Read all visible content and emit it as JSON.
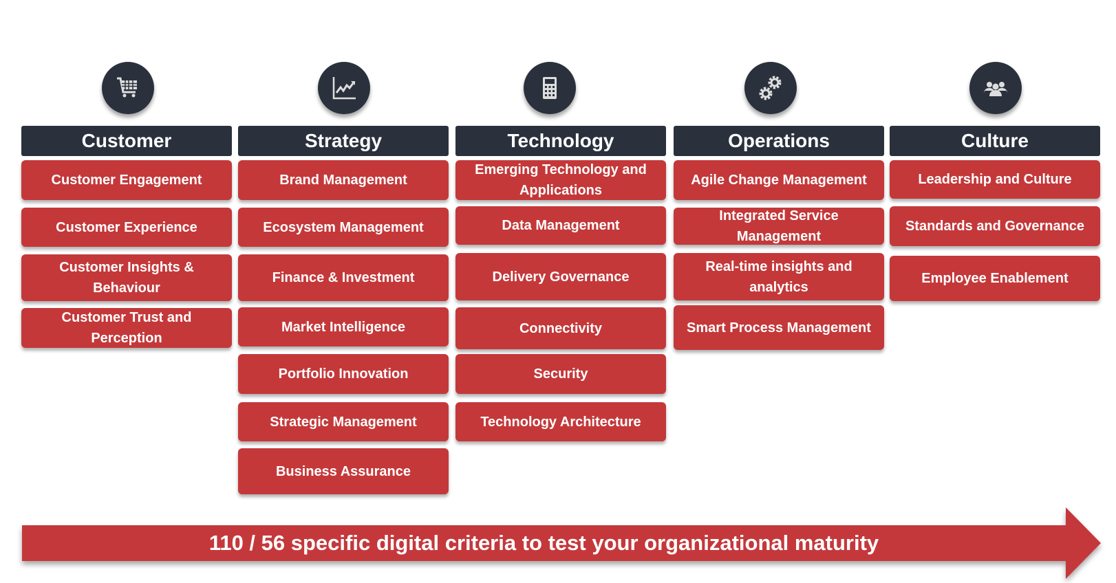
{
  "colors": {
    "accent": "#c4383a",
    "header": "#2a313c"
  },
  "columns": [
    {
      "title": "Customer",
      "icon": "shopping-cart-icon",
      "items": [
        "Customer Engagement",
        "Customer Experience",
        "Customer Insights & Behaviour",
        "Customer Trust and Perception"
      ]
    },
    {
      "title": "Strategy",
      "icon": "trend-chart-icon",
      "items": [
        "Brand Management",
        "Ecosystem Management",
        "Finance & Investment",
        "Market Intelligence",
        "Portfolio Innovation",
        "Strategic Management",
        "Business Assurance"
      ]
    },
    {
      "title": "Technology",
      "icon": "calculator-icon",
      "items": [
        "Emerging Technology and Applications",
        "Data Management",
        "Delivery Governance",
        "Connectivity",
        "Security",
        "Technology Architecture"
      ]
    },
    {
      "title": "Operations",
      "icon": "gears-icon",
      "items": [
        "Agile Change Management",
        "Integrated Service Management",
        "Real-time insights and analytics",
        "Smart Process Management"
      ]
    },
    {
      "title": "Culture",
      "icon": "people-icon",
      "items": [
        "Leadership and Culture",
        "Standards and Governance",
        "Employee Enablement"
      ]
    }
  ],
  "footer": {
    "text": "110 / 56 specific digital criteria to test your organizational maturity"
  }
}
